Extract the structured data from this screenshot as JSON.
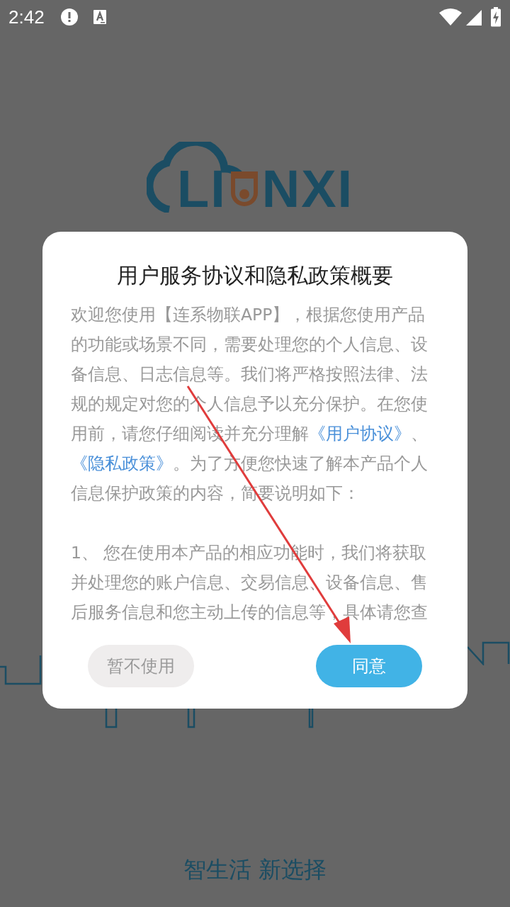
{
  "status_bar": {
    "time": "2:42"
  },
  "logo": {
    "text_left": "LI",
    "text_right": "NXI"
  },
  "dialog": {
    "title": "用户服务协议和隐私政策概要",
    "paragraphs": [
      [
        {
          "kind": "text",
          "text": "欢迎您使用【连系物联APP】，根据您使用产品的功能或场景不同，需要处理您的个人信息、设备信息、日志信息等。我们将严格按照法律、法规的规定对您的个人信息予以充分保护。在您使用前，请您仔细阅读并充分理解"
        },
        {
          "kind": "link",
          "text": "《用户协议》"
        },
        {
          "kind": "text",
          "text": "、"
        },
        {
          "kind": "link",
          "text": "《隐私政策》"
        },
        {
          "kind": "text",
          "text": "。为了方便您快速了解本产品个人信息保护政策的内容，简要说明如下："
        }
      ],
      [
        {
          "kind": "text",
          "text": "1、 您在使用本产品的相应功能时，我们将获取并处理您的账户信息、交易信息、设备信息、售后服务信息和您主动上传的信息等，具体请您查"
        }
      ]
    ],
    "buttons": [
      {
        "label": "暂不使用",
        "kind": "secondary"
      },
      {
        "label": "同意",
        "kind": "primary"
      }
    ]
  },
  "slogan": "智生活 新选择"
}
